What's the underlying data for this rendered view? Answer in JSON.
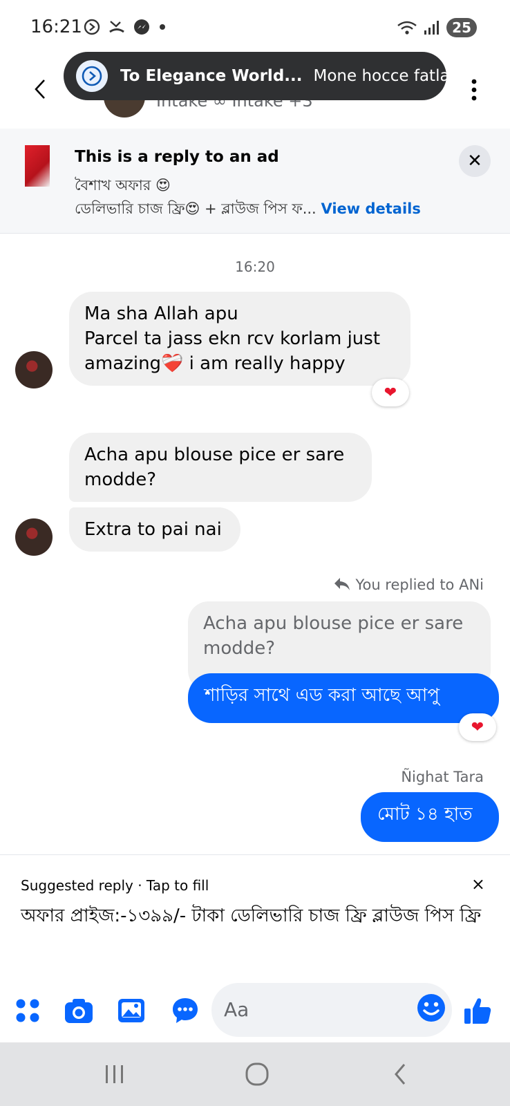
{
  "status_bar": {
    "time": "16:21",
    "battery": "25",
    "icons_left": [
      "sync-icon",
      "missed-call-icon",
      "messenger-icon",
      "dot-icon"
    ],
    "icons_right": [
      "wifi-icon",
      "signal-icon"
    ]
  },
  "header": {
    "subtitle": "Intake ∞ Intake +3"
  },
  "toast": {
    "title": "To Elegance World...",
    "message": "Mone hocce fatla"
  },
  "ad_reply": {
    "title": "This is a reply to an ad",
    "line1": "বৈশাখ অফার 😍",
    "line2": "ডেলিভারি চাজ ফ্রি😍 + ব্লাউজ পিস ফ...",
    "link": "View details"
  },
  "chat": {
    "timestamp": "16:20",
    "messages": [
      {
        "text_lines": [
          "Ma sha Allah apu",
          "Parcel ta jass ekn rcv korlam just",
          "amazing❤️‍🩹 i am really happy"
        ],
        "reaction": "❤"
      },
      {
        "text_lines": [
          "Acha apu blouse pice er sare",
          "modde?"
        ]
      },
      {
        "text": "Extra to pai nai"
      }
    ],
    "reply_label": "You replied to ANi",
    "quoted_lines": [
      "Acha apu blouse pice er sare",
      "modde?"
    ],
    "reply_text": "শাড়ির সাথে এড করা আছে আপু",
    "reply_reaction": "❤",
    "sender_name": "Ñighat Tara",
    "last_out": "মোট ১৪ হাত"
  },
  "suggested_reply": {
    "header": "Suggested reply · Tap to fill",
    "close": "×",
    "text": "অফার প্রাইজ:-১৩৯৯/- টাকা ডেলিভারি চাজ ফ্রি ব্লাউজ পিস ফ্রি"
  },
  "composer": {
    "placeholder": "Aa"
  },
  "colors": {
    "accent": "#0866ff",
    "incoming_bubble": "#f0f0f0",
    "heart": "#e8162e"
  }
}
